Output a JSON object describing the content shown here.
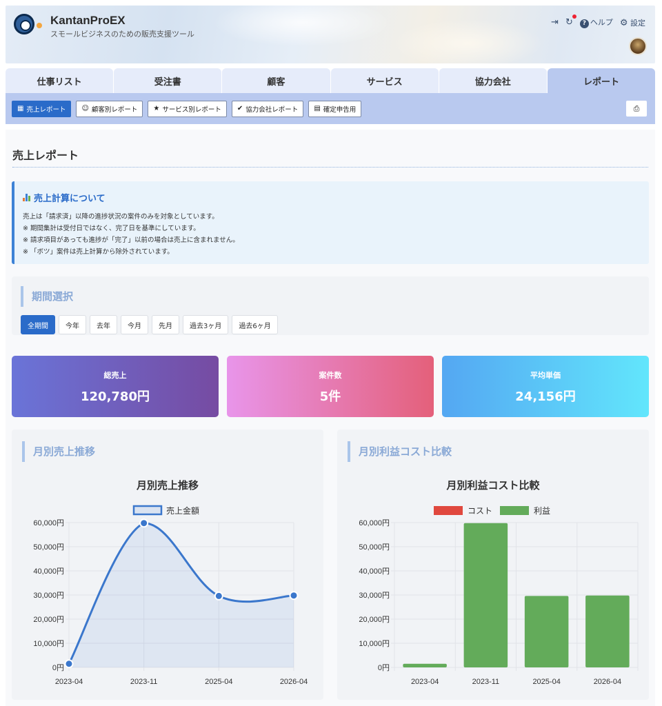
{
  "app": {
    "title": "KantanProEX",
    "subtitle": "スモールビジネスのための販売支援ツール",
    "actions": {
      "help": "ヘルプ",
      "settings": "設定"
    }
  },
  "tabs": [
    {
      "label": "仕事リスト",
      "active": false
    },
    {
      "label": "受注書",
      "active": false
    },
    {
      "label": "顧客",
      "active": false
    },
    {
      "label": "サービス",
      "active": false
    },
    {
      "label": "協力会社",
      "active": false
    },
    {
      "label": "レポート",
      "active": true
    }
  ],
  "subnav": [
    {
      "label": "売上レポート",
      "icon": "dashboard-icon",
      "active": true
    },
    {
      "label": "顧客別レポート",
      "icon": "user-icon",
      "active": false
    },
    {
      "label": "サービス別レポート",
      "icon": "star-icon",
      "active": false
    },
    {
      "label": "協力会社レポート",
      "icon": "check-circle-icon",
      "active": false
    },
    {
      "label": "確定申告用",
      "icon": "document-icon",
      "active": false
    }
  ],
  "page": {
    "title": "売上レポート"
  },
  "info": {
    "title": "売上計算について",
    "lines": [
      "売上は「請求済」以降の進捗状況の案件のみを対象としています。",
      "※ 期間集計は受付日ではなく、完了日を基準にしています。",
      "※ 請求項目があっても進捗が「完了」以前の場合は売上に含まれません。",
      "※ 「ボツ」案件は売上計算から除外されています。"
    ]
  },
  "period": {
    "title": "期間選択",
    "options": [
      {
        "label": "全期間",
        "active": true
      },
      {
        "label": "今年",
        "active": false
      },
      {
        "label": "去年",
        "active": false
      },
      {
        "label": "今月",
        "active": false
      },
      {
        "label": "先月",
        "active": false
      },
      {
        "label": "過去3ヶ月",
        "active": false
      },
      {
        "label": "過去6ヶ月",
        "active": false
      }
    ]
  },
  "stats": {
    "total": {
      "label": "総売上",
      "value": "120,780円"
    },
    "count": {
      "label": "案件数",
      "value": "5件"
    },
    "average": {
      "label": "平均単価",
      "value": "24,156円"
    }
  },
  "sections": {
    "sales_trend": "月別売上推移",
    "profit_cost": "月別利益コスト比較"
  },
  "colors": {
    "accent": "#2a6bc9",
    "line": "#3b77cc",
    "cost": "#e0483e",
    "profit": "#63ab5a"
  },
  "chart_data": [
    {
      "type": "line",
      "title": "月別売上推移",
      "categories": [
        "2023-04",
        "2023-11",
        "2025-04",
        "2026-04"
      ],
      "series": [
        {
          "name": "売上金額",
          "values": [
            1500,
            59800,
            29600,
            29800
          ]
        }
      ],
      "ylim": [
        0,
        60000
      ],
      "yticks": [
        "0円",
        "10,000円",
        "20,000円",
        "30,000円",
        "40,000円",
        "50,000円",
        "60,000円"
      ],
      "legend": "top",
      "grid": true
    },
    {
      "type": "bar",
      "title": "月別利益コスト比較",
      "categories": [
        "2023-04",
        "2023-11",
        "2025-04",
        "2026-04"
      ],
      "series": [
        {
          "name": "コスト",
          "values": [
            0,
            0,
            0,
            0
          ]
        },
        {
          "name": "利益",
          "values": [
            1500,
            59800,
            29600,
            29800
          ]
        }
      ],
      "ylim": [
        0,
        60000
      ],
      "yticks": [
        "0円",
        "10,000円",
        "20,000円",
        "30,000円",
        "40,000円",
        "50,000円",
        "60,000円"
      ],
      "stacked": true,
      "legend": "top",
      "grid": true
    }
  ]
}
